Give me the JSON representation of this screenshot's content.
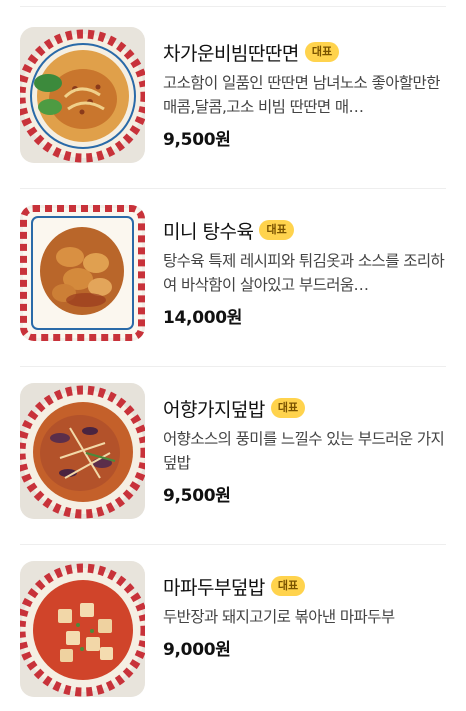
{
  "menu": {
    "badge_label": "대표",
    "items": [
      {
        "name": "차가운비빔딴딴면",
        "description": "고소함이 일품인 딴딴면 남녀노소 좋아할만한 매콤,달콤,고소 비빔 딴딴면 매…",
        "price": "9,500원",
        "image": "cold-spicy-noodles-photo"
      },
      {
        "name": "미니 탕수육",
        "description": "탕수육 특제 레시피와 튀김옷과 소스를 조리하여 바삭함이 살아있고 부드러움…",
        "price": "14,000원",
        "image": "sweet-sour-pork-photo"
      },
      {
        "name": "어향가지덮밥",
        "description": "어향소스의 풍미를 느낄수 있는 부드러운 가지 덮밥",
        "price": "9,500원",
        "image": "eggplant-rice-bowl-photo"
      },
      {
        "name": "마파두부덮밥",
        "description": "두반장과 돼지고기로 볶아낸 마파두부",
        "price": "9,000원",
        "image": "mapo-tofu-rice-bowl-photo"
      }
    ]
  },
  "colors": {
    "badge_bg": "#ffd34d",
    "badge_text": "#7a5300",
    "price_text": "#111111",
    "description_text": "#444444",
    "plate_pattern_red": "#c8323a"
  }
}
